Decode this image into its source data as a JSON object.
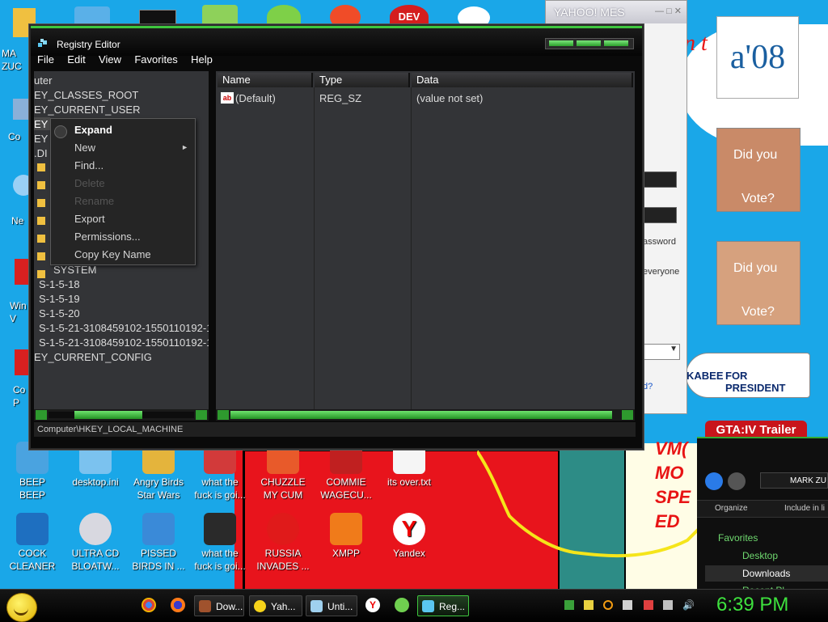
{
  "desktop_banners": {
    "a08": "a'08",
    "speech_fragment": "n t",
    "vote_line1": "Did you",
    "vote_line2": "Vote?",
    "huckabee_left": "KABEE",
    "huckabee_right": "FOR PRESIDENT",
    "vmo": [
      "VM(",
      "MO",
      "SPE",
      "ED"
    ]
  },
  "yahoo_window": {
    "title": "YAHOO! MES",
    "password_label": "assword",
    "everyone_label": "everyone",
    "link_fragment": "d?"
  },
  "gta_window": {
    "tab": "GTA:IV  Trailer",
    "address": "MARK ZU",
    "organize": "Organize",
    "include": "Include in li",
    "favorites": "Favorites",
    "desktop": "Desktop",
    "downloads": "Downloads",
    "recent": "Recent Pl"
  },
  "left_icons": [
    {
      "label": "MA\nZUC"
    },
    {
      "label": "Co"
    },
    {
      "label": "Ne"
    },
    {
      "label": "Win\nV"
    },
    {
      "label": "Co\nP"
    }
  ],
  "desktop_icons_row1": [
    {
      "label": "BEEP\nBEEP"
    },
    {
      "label": "desktop.ini"
    },
    {
      "label": "Angry Birds\nStar Wars"
    },
    {
      "label": "what the\nfuck is goi..."
    },
    {
      "label": "CHUZZLE\nMY CUM"
    },
    {
      "label": "COMMIE\nWAGECU..."
    },
    {
      "label": "its over.txt"
    }
  ],
  "desktop_icons_row2": [
    {
      "label": "COCK\nCLEANER"
    },
    {
      "label": "ULTRA CD\nBLOATW..."
    },
    {
      "label": "PISSED\nBIRDS IN ..."
    },
    {
      "label": "what the\nfuck is goi..."
    },
    {
      "label": "RUSSIA\nINVADES ..."
    },
    {
      "label": "XMPP"
    },
    {
      "label": "Yandex"
    }
  ],
  "registry": {
    "title": "Registry Editor",
    "menu": [
      "File",
      "Edit",
      "View",
      "Favorites",
      "Help"
    ],
    "tree": [
      "uter",
      "EY_CLASSES_ROOT",
      "EY_CURRENT_USER",
      "EY",
      "EY",
      ".DI",
      "SYSTEM",
      "S-1-5-18",
      "S-1-5-19",
      "S-1-5-20",
      "S-1-5-21-3108459102-1550110192-19",
      "S-1-5-21-3108459102-1550110192-19",
      "EY_CURRENT_CONFIG"
    ],
    "columns": [
      "Name",
      "Type",
      "Data"
    ],
    "rows": [
      {
        "name": "(Default)",
        "type": "REG_SZ",
        "data": "(value not set)"
      }
    ],
    "status": "Computer\\HKEY_LOCAL_MACHINE"
  },
  "context_menu": {
    "items": [
      {
        "label": "Expand",
        "state": "bold"
      },
      {
        "label": "New",
        "state": "submenu"
      },
      {
        "label": "Find...",
        "state": "normal"
      },
      {
        "label": "Delete",
        "state": "disabled"
      },
      {
        "label": "Rename",
        "state": "disabled"
      },
      {
        "label": "Export",
        "state": "normal"
      },
      {
        "label": "Permissions...",
        "state": "normal"
      },
      {
        "label": "Copy Key Name",
        "state": "normal"
      }
    ]
  },
  "taskbar": {
    "buttons": [
      {
        "label": "Dow..."
      },
      {
        "label": "Yah..."
      },
      {
        "label": "Unti..."
      },
      {
        "label": "Reg..."
      }
    ],
    "clock": "6:39 PM"
  },
  "colors": {
    "desktop": "#1aa7e8",
    "accent_green": "#3ec63e",
    "window_bg": "#0a0a0a",
    "pane_bg": "#333437"
  }
}
